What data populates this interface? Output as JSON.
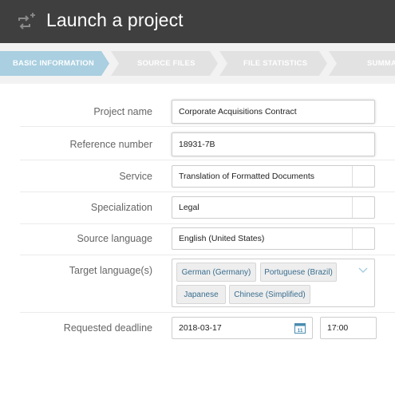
{
  "header": {
    "title": "Launch a project",
    "icon": "add-transfer-icon"
  },
  "steps": [
    {
      "label": "BASIC INFORMATION",
      "active": true
    },
    {
      "label": "SOURCE FILES",
      "active": false
    },
    {
      "label": "FILE STATISTICS",
      "active": false
    },
    {
      "label": "SUMMA",
      "active": false
    }
  ],
  "colors": {
    "header_bg": "#3f3f3f",
    "active_step": "#a9cfe0",
    "inactive_step": "#e2e2e2",
    "tag_text": "#3a6e8f",
    "accent": "#4a8db0"
  },
  "form": {
    "project_name": {
      "label": "Project name",
      "value": "Corporate Acquisitions Contract"
    },
    "reference_number": {
      "label": "Reference number",
      "value": "18931-7B"
    },
    "service": {
      "label": "Service",
      "value": "Translation of Formatted Documents"
    },
    "specialization": {
      "label": "Specialization",
      "value": "Legal"
    },
    "source_language": {
      "label": "Source language",
      "value": "English (United States)"
    },
    "target_languages": {
      "label": "Target language(s)",
      "values": [
        "German (Germany)",
        "Portuguese (Brazil)",
        "Japanese",
        "Chinese (Simplified)"
      ]
    },
    "deadline": {
      "label": "Requested deadline",
      "date": "2018-03-17",
      "time": "17:00",
      "calendar_day": "11"
    }
  }
}
